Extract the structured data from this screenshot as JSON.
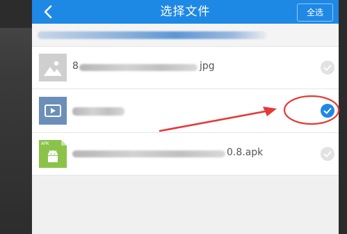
{
  "header": {
    "title": "选择文件",
    "select_all_label": "全选",
    "accent_color": "#1e88e5"
  },
  "files": [
    {
      "type_icon": "image-icon",
      "name_visible": "jpg",
      "name_prefix_visible": "8",
      "selected": false
    },
    {
      "type_icon": "video-icon",
      "name_visible": "",
      "selected": true
    },
    {
      "type_icon": "apk-icon",
      "badge": "APK",
      "name_visible": "0.8.apk",
      "selected": false
    }
  ],
  "annotation": {
    "color": "#e53935",
    "shape": "arrow-and-ellipse"
  }
}
